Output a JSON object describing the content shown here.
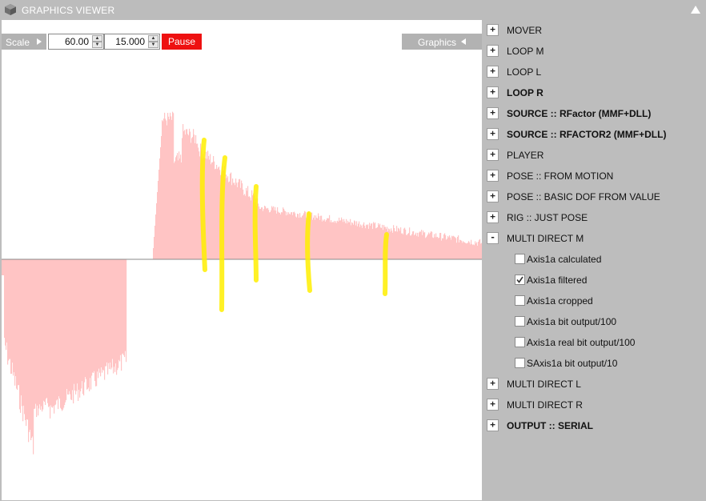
{
  "window": {
    "title": "GRAPHICS VIEWER",
    "logo_icon": "cube-logo-icon",
    "collapse_icon": "triangle-up-icon"
  },
  "toolbar": {
    "scale_label": "Scale",
    "scale_value_a": "60.00",
    "scale_value_b": "15.000",
    "pause_label": "Pause",
    "graphics_label": "Graphics",
    "pause_color": "#ee1111"
  },
  "graph": {
    "fill_color": "#ffc4c4",
    "highlight_color": "#ffee00"
  },
  "tree": {
    "items": [
      {
        "label": "MOVER",
        "expanded": false,
        "bold": false
      },
      {
        "label": "LOOP M",
        "expanded": false,
        "bold": false
      },
      {
        "label": "LOOP L",
        "expanded": false,
        "bold": false
      },
      {
        "label": "LOOP R",
        "expanded": false,
        "bold": true
      },
      {
        "label": "SOURCE :: RFactor (MMF+DLL)",
        "expanded": false,
        "bold": true
      },
      {
        "label": "SOURCE :: RFACTOR2 (MMF+DLL)",
        "expanded": false,
        "bold": true
      },
      {
        "label": "PLAYER",
        "expanded": false,
        "bold": false
      },
      {
        "label": "POSE :: FROM MOTION",
        "expanded": false,
        "bold": false
      },
      {
        "label": "POSE :: BASIC DOF FROM VALUE",
        "expanded": false,
        "bold": false
      },
      {
        "label": "RIG :: JUST POSE",
        "expanded": false,
        "bold": false
      },
      {
        "label": "MULTI DIRECT M",
        "expanded": true,
        "bold": false,
        "children": [
          {
            "label": "Axis1a calculated",
            "checked": false
          },
          {
            "label": "Axis1a filtered",
            "checked": true
          },
          {
            "label": "Axis1a cropped",
            "checked": false
          },
          {
            "label": "Axis1a bit output/100",
            "checked": false
          },
          {
            "label": "Axis1a real bit output/100",
            "checked": false
          },
          {
            "label": "SAxis1a bit output/10",
            "checked": false
          }
        ]
      },
      {
        "label": "MULTI DIRECT L",
        "expanded": false,
        "bold": false
      },
      {
        "label": "MULTI DIRECT R",
        "expanded": false,
        "bold": false
      },
      {
        "label": "OUTPUT :: SERIAL",
        "expanded": false,
        "bold": true
      }
    ]
  }
}
